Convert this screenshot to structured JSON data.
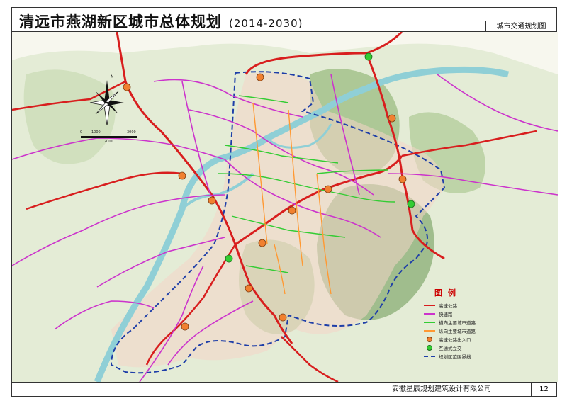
{
  "header": {
    "title": "清远市燕湖新区城市总体规划",
    "years": "(2014-2030)",
    "subtitle": "城市交通规划图"
  },
  "footer": {
    "company": "安徽星辰规划建筑设计有限公司",
    "page": "12"
  },
  "compass": {
    "north_label": "N"
  },
  "scale": {
    "labels": [
      "0",
      "1000",
      "3000",
      "2000"
    ]
  },
  "legend": {
    "title": "图例",
    "items": [
      {
        "label": "高速公路",
        "color": "#d81e1e",
        "kind": "line"
      },
      {
        "label": "快速路",
        "color": "#cc33cc",
        "kind": "line"
      },
      {
        "label": "横向主要城市道路",
        "color": "#33cc33",
        "kind": "line"
      },
      {
        "label": "纵向主要城市道路",
        "color": "#ff9933",
        "kind": "line"
      },
      {
        "label": "高速公路出入口",
        "color": "#f08030",
        "kind": "dot"
      },
      {
        "label": "互通式立交",
        "color": "#33cc33",
        "kind": "dot"
      },
      {
        "label": "规划区范围界线",
        "color": "#1e3ea8",
        "kind": "dash"
      }
    ]
  }
}
